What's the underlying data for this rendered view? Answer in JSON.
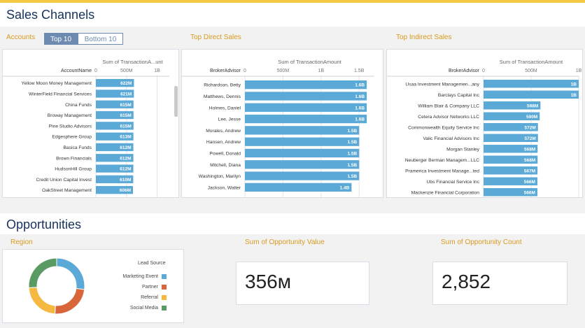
{
  "sales": {
    "title": "Sales Channels",
    "accounts_label": "Accounts",
    "toggle_top": "Top 10",
    "toggle_bottom": "Bottom 10",
    "top_direct_label": "Top Direct Sales",
    "top_indirect_label": "Top Indirect Sales"
  },
  "opportunities": {
    "title": "Opportunities",
    "region_label": "Region",
    "value_label": "Sum of Opportunity Value",
    "count_label": "Sum of Opportunity Count",
    "value": "356м",
    "count": "2,852",
    "legend_title": "Lead Source",
    "legend": [
      {
        "label": "Marketing Event",
        "color": "#5aa9d6"
      },
      {
        "label": "Partner",
        "color": "#d9663a"
      },
      {
        "label": "Referral",
        "color": "#f5b942"
      },
      {
        "label": "Social Media",
        "color": "#5c9a63"
      }
    ]
  },
  "chart_data": [
    {
      "type": "bar",
      "orientation": "horizontal",
      "title": "Sum of TransactionA...unt",
      "ylabel": "AccountName",
      "ticks": [
        "0",
        "500M",
        "1B"
      ],
      "xlim": [
        0,
        1200
      ],
      "bar_color": "#5aa9d6",
      "categories": [
        "Yellow Moon Money Management",
        "WinterField Financial Services",
        "China Funds",
        "Broway Management",
        "Pine Studio Advisors",
        "Edgesphere Group",
        "Basica Funds",
        "Brown Financials",
        "HudsonHill Group",
        "Credit Union Capital Invest",
        "OakStreet Management"
      ],
      "values": [
        622,
        621,
        615,
        615,
        615,
        613,
        612,
        612,
        612,
        610,
        606
      ],
      "labels": [
        "622M",
        "621M",
        "615M",
        "615M",
        "615M",
        "613M",
        "612M",
        "612M",
        "612M",
        "610M",
        "606M"
      ]
    },
    {
      "type": "bar",
      "orientation": "horizontal",
      "title": "Sum of TransactionAmount",
      "ylabel": "BrokerAdvisor",
      "ticks": [
        "0",
        "500M",
        "1B",
        "1.5B"
      ],
      "xlim": [
        0,
        1700
      ],
      "bar_color": "#5aa9d6",
      "categories": [
        "Richardson, Betty",
        "Matthews, Dennis",
        "Holmes, Daniel",
        "Lee, Jesse",
        "Morales, Andrew",
        "Hansen, Andrew",
        "Powell, Donald",
        "Mitchell, Diana",
        "Washington, Marilyn",
        "Jackson, Walter"
      ],
      "values": [
        1600,
        1600,
        1600,
        1600,
        1500,
        1500,
        1500,
        1500,
        1500,
        1400
      ],
      "labels": [
        "1.6B",
        "1.6B",
        "1.6B",
        "1.6B",
        "1.5B",
        "1.5B",
        "1.5B",
        "1.5B",
        "1.5B",
        "1.4B"
      ]
    },
    {
      "type": "bar",
      "orientation": "horizontal",
      "title": "Sum of TransactionAmount",
      "ylabel": "BrokerAdvisor",
      "ticks": [
        "0",
        "500M",
        "1B"
      ],
      "xlim": [
        0,
        1000
      ],
      "bar_color": "#5aa9d6",
      "categories": [
        "Usaa Investment Managemen...any",
        "Barclays Capital Inc",
        "William Blair & Company LLC",
        "Cetera Advisor Networks LLC",
        "Commonwealth Equity Service Inc",
        "Valic Financial Advisors Inc",
        "Morgan Stanley",
        "Neuberger Berman Managem...LLC",
        "Pramerica Investment Manage...ted",
        "Ubs Financial Service Inc",
        "Mackenzie Financial Corporation"
      ],
      "values": [
        1000,
        1000,
        598,
        590,
        572,
        572,
        568,
        568,
        567,
        566,
        566
      ],
      "labels": [
        "1B",
        "1B",
        "598M",
        "590M",
        "572M",
        "572M",
        "568M",
        "568M",
        "567M",
        "566M",
        "566M"
      ]
    },
    {
      "type": "pie",
      "donut": true,
      "categories": [
        "Marketing Event",
        "Partner",
        "Referral",
        "Social Media"
      ],
      "values": [
        27,
        24,
        23,
        26
      ],
      "colors": [
        "#5aa9d6",
        "#d9663a",
        "#f5b942",
        "#5c9a63"
      ]
    }
  ]
}
